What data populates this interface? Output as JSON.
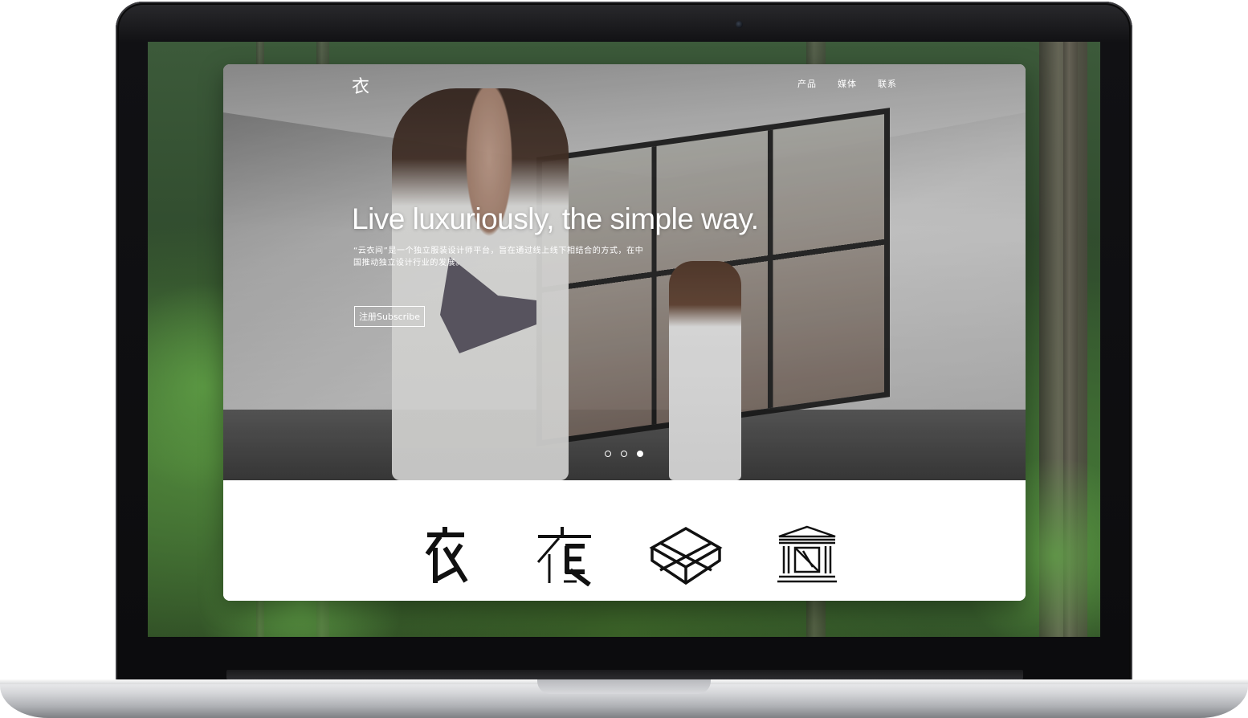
{
  "site": {
    "logo_glyph": "衣",
    "nav": [
      "产品",
      "媒体",
      "联系"
    ],
    "headline": "Live luxuriously, the simple way.",
    "description_line1": "“云衣间”是一个独立服装设计师平台，旨在通过线上线下相结合的方式，在中",
    "description_line2": "国推动独立设计行业的发展。",
    "subscribe_label": "注册Subscribe",
    "carousel": {
      "slides": 3,
      "active_index": 3
    },
    "icons": [
      "yun-logo-icon",
      "yi-logo-icon",
      "box-icon",
      "gallery-building-icon"
    ]
  },
  "colors": {
    "screen_bezel": "#0c0c0e",
    "hero_text": "#ffffff",
    "icon_stroke": "#111111",
    "panel_bg": "#ffffff"
  }
}
